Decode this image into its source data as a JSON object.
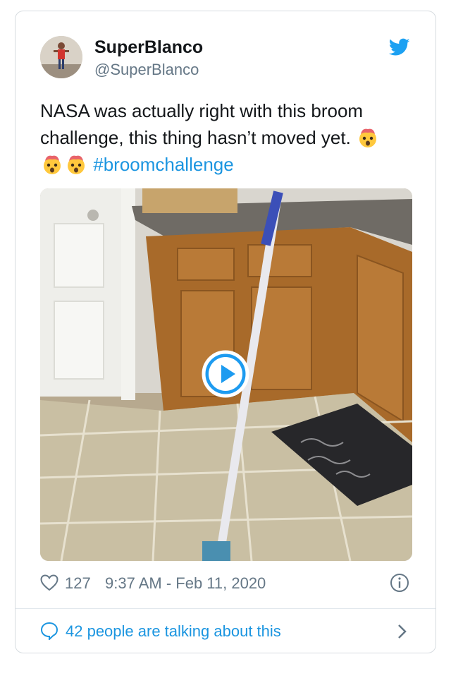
{
  "author": {
    "display_name": "SuperBlanco",
    "handle": "@SuperBlanco",
    "avatar_icon": "person-photo-avatar"
  },
  "tweet": {
    "text_line1": "NASA was actually right with this broom",
    "text_line2": "challenge, this thing hasn’t moved yet.",
    "hashtag": "#broomchallenge",
    "emoji_icon": "exploding-head-emoji"
  },
  "media": {
    "kind": "video",
    "play_icon": "play-icon"
  },
  "footer": {
    "likes": "127",
    "timestamp": "9:37 AM - Feb 11, 2020",
    "heart_icon": "heart-icon",
    "info_icon": "info-icon"
  },
  "conversation": {
    "label": "42 people are talking about this",
    "bubble_icon": "speech-bubble-icon",
    "chevron_icon": "chevron-right-icon"
  },
  "colors": {
    "link": "#1b95e0",
    "secondary_text": "#657786",
    "border": "#d7dce0"
  }
}
